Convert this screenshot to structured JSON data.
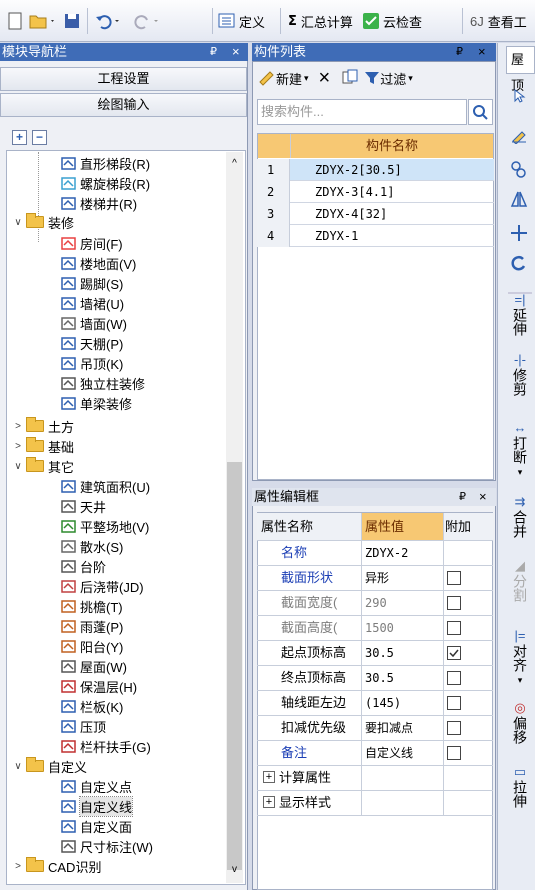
{
  "toolbar": {
    "define": "定义",
    "sum": "汇总计算",
    "cloud_check": "云检查",
    "view_project": "查看工"
  },
  "nav_panel": {
    "title": "模块导航栏",
    "pin": "₽",
    "close": "×",
    "btn_project": "工程设置",
    "btn_draw": "绘图输入",
    "tree": [
      {
        "label": "直形梯段(R)",
        "icon": "straight-stair-icon"
      },
      {
        "label": "螺旋梯段(R)",
        "icon": "spiral-stair-icon"
      },
      {
        "label": "楼梯井(R)",
        "icon": "stairwell-icon"
      },
      {
        "label": "装修",
        "icon": "folder-icon",
        "group": true
      },
      {
        "label": "房间(F)",
        "icon": "room-icon"
      },
      {
        "label": "楼地面(V)",
        "icon": "floor-icon"
      },
      {
        "label": "踢脚(S)",
        "icon": "skirting-icon"
      },
      {
        "label": "墙裙(U)",
        "icon": "dado-icon"
      },
      {
        "label": "墙面(W)",
        "icon": "wall-face-icon"
      },
      {
        "label": "天棚(P)",
        "icon": "ceiling-icon"
      },
      {
        "label": "吊顶(K)",
        "icon": "suspended-ceiling-icon"
      },
      {
        "label": "独立柱装修",
        "icon": "column-finish-icon"
      },
      {
        "label": "单梁装修",
        "icon": "beam-finish-icon"
      },
      {
        "label": "土方",
        "icon": "folder-icon",
        "group": true
      },
      {
        "label": "基础",
        "icon": "folder-icon",
        "group": true
      },
      {
        "label": "其它",
        "icon": "folder-icon",
        "group": true
      },
      {
        "label": "建筑面积(U)",
        "icon": "building-area-icon"
      },
      {
        "label": "天井",
        "icon": "patio-icon"
      },
      {
        "label": "平整场地(V)",
        "icon": "site-leveling-icon"
      },
      {
        "label": "散水(S)",
        "icon": "apron-icon"
      },
      {
        "label": "台阶",
        "icon": "steps-icon"
      },
      {
        "label": "后浇带(JD)",
        "icon": "post-pour-strip-icon"
      },
      {
        "label": "挑檐(T)",
        "icon": "eave-icon"
      },
      {
        "label": "雨蓬(P)",
        "icon": "canopy-icon"
      },
      {
        "label": "阳台(Y)",
        "icon": "balcony-icon"
      },
      {
        "label": "屋面(W)",
        "icon": "roof-icon"
      },
      {
        "label": "保温层(H)",
        "icon": "insulation-icon"
      },
      {
        "label": "栏板(K)",
        "icon": "parapet-icon"
      },
      {
        "label": "压顶",
        "icon": "coping-icon"
      },
      {
        "label": "栏杆扶手(G)",
        "icon": "railing-icon"
      },
      {
        "label": "自定义",
        "icon": "folder-icon",
        "group": true
      },
      {
        "label": "自定义点",
        "icon": "custom-point-icon"
      },
      {
        "label": "自定义线",
        "icon": "custom-line-icon"
      },
      {
        "label": "自定义面",
        "icon": "custom-face-icon"
      },
      {
        "label": "尺寸标注(W)",
        "icon": "dimension-icon"
      },
      {
        "label": "CAD识别",
        "icon": "folder-icon",
        "group": true
      }
    ]
  },
  "component_list": {
    "title": "构件列表",
    "pin": "₽",
    "close": "×",
    "new_btn": "新建",
    "delete": "×",
    "filter": "过滤",
    "search_placeholder": "搜索构件...",
    "header": "构件名称",
    "rows": [
      {
        "num": "1",
        "name": "ZDYX-2[30.5]"
      },
      {
        "num": "2",
        "name": "ZDYX-3[4.1]"
      },
      {
        "num": "3",
        "name": "ZDYX-4[32]"
      },
      {
        "num": "4",
        "name": "ZDYX-1"
      }
    ]
  },
  "prop_panel": {
    "title": "属性编辑框",
    "pin": "₽",
    "close": "×",
    "col_name": "属性名称",
    "col_value": "属性值",
    "col_extra": "附加",
    "rows": [
      {
        "name": "名称",
        "value": "ZDYX-2",
        "style": "blue",
        "check": "none"
      },
      {
        "name": "截面形状",
        "value": "异形",
        "style": "blue",
        "check": "off"
      },
      {
        "name": "截面宽度(",
        "value": "290",
        "style": "grey",
        "check": "off"
      },
      {
        "name": "截面高度(",
        "value": "1500",
        "style": "grey",
        "check": "off"
      },
      {
        "name": "起点顶标高",
        "value": "30.5",
        "style": "",
        "check": "on"
      },
      {
        "name": "终点顶标高",
        "value": "30.5",
        "style": "",
        "check": "off"
      },
      {
        "name": "轴线距左边",
        "value": "(145)",
        "style": "",
        "check": "off"
      },
      {
        "name": "扣减优先级",
        "value": "要扣减点",
        "style": "",
        "check": "off"
      },
      {
        "name": "备注",
        "value": "自定义线",
        "style": "blue",
        "check": "off"
      },
      {
        "name": "计算属性",
        "value": "",
        "style": "",
        "check": "group"
      },
      {
        "name": "显示样式",
        "value": "",
        "style": "",
        "check": "group"
      }
    ],
    "plus": "+"
  },
  "right_toolbar": {
    "tab": "屋顶",
    "extend": "延伸",
    "trim": "修剪",
    "break": "打断",
    "merge": "合并",
    "split": "分割",
    "align": "对齐",
    "offset": "偏移",
    "stretch": "拉伸"
  },
  "colors": {
    "title_blue": "#3f6cb7",
    "header_orange": "#f7c873",
    "selected_row": "#cfe4f8"
  }
}
